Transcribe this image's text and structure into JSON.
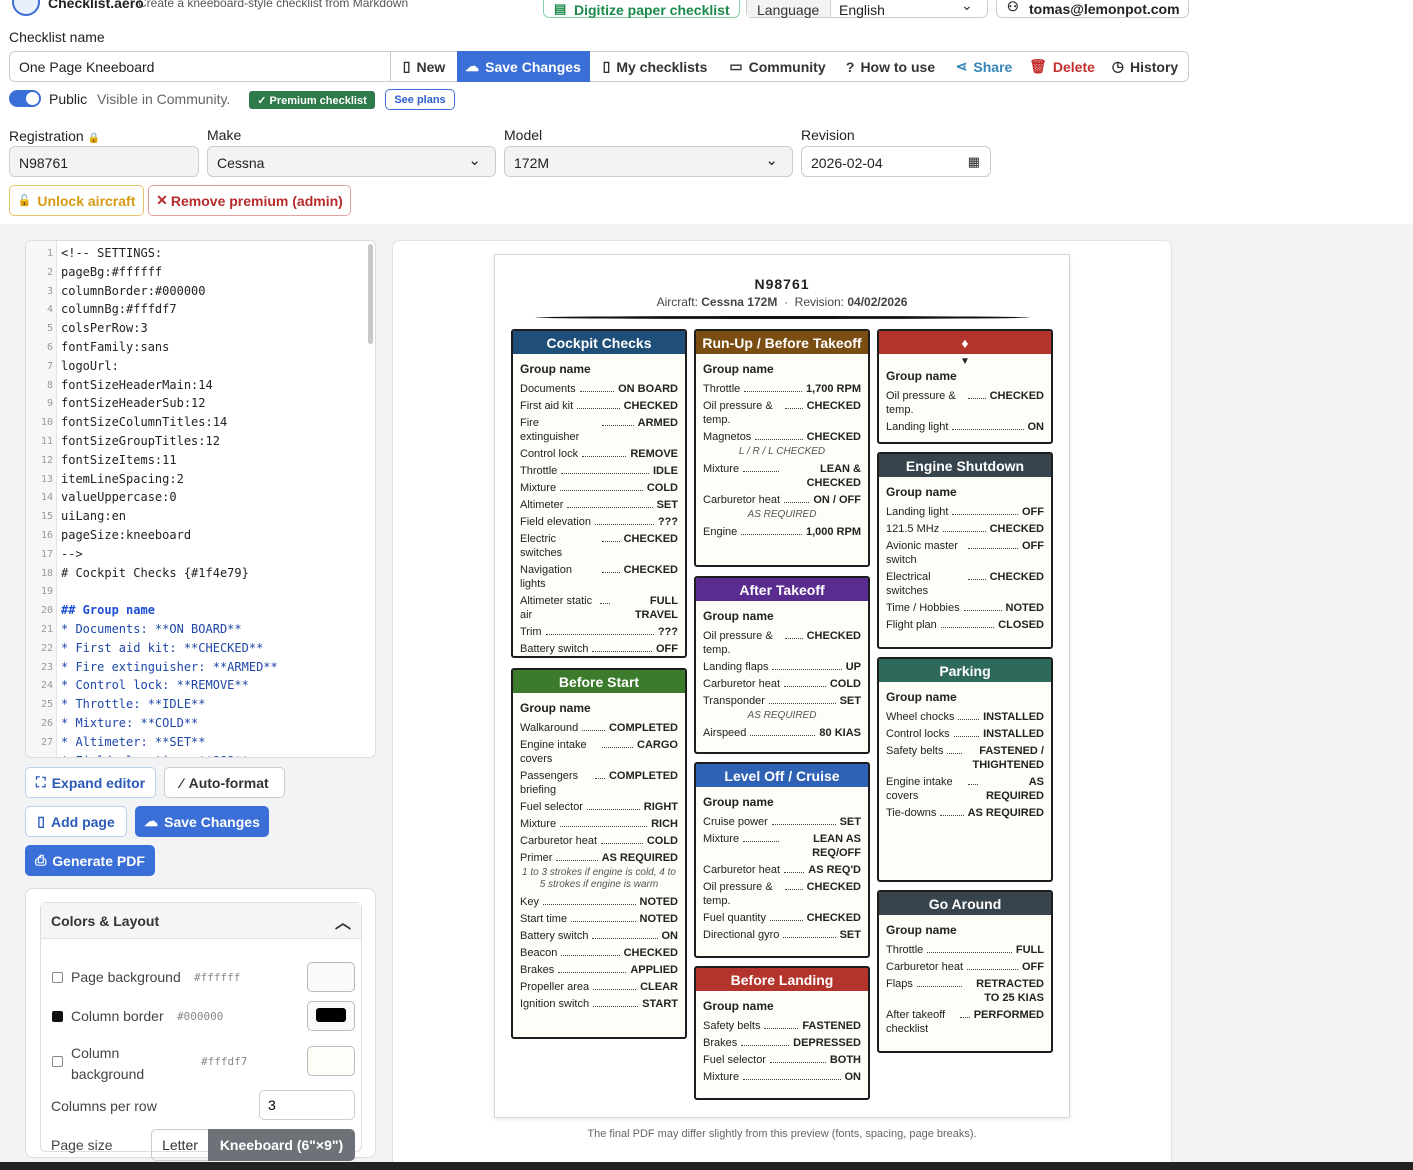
{
  "app": {
    "name": "Checklist.aero",
    "tagline": "Create a kneeboard-style checklist from Markdown",
    "digitize_label": "Digitize paper checklist",
    "language_label": "Language",
    "language_value": "English",
    "user": "tomas@lemonpot.com"
  },
  "checklist": {
    "name_label": "Checklist name",
    "name_value": "One Page Kneeboard"
  },
  "toolbar": {
    "new": "New",
    "save": "Save Changes",
    "my": "My checklists",
    "community": "Community",
    "how": "How to use",
    "share": "Share",
    "delete": "Delete",
    "history": "History"
  },
  "visibility": {
    "public_label": "Public",
    "hint": "Visible in Community.",
    "premium": "✓ Premium checklist",
    "see_plans": "See plans"
  },
  "aircraft": {
    "registration_label": "Registration",
    "registration_value": "N98761",
    "make_label": "Make",
    "make_value": "Cessna",
    "model_label": "Model",
    "model_value": "172M",
    "revision_label": "Revision",
    "revision_value": "2026-02-04",
    "unlock": "Unlock aircraft",
    "remove_premium": "Remove premium (admin)"
  },
  "editor": {
    "lines": [
      "<!-- SETTINGS:",
      "pageBg:#ffffff",
      "columnBorder:#000000",
      "columnBg:#fffdf7",
      "colsPerRow:3",
      "fontFamily:sans",
      "logoUrl:",
      "fontSizeHeaderMain:14",
      "fontSizeHeaderSub:12",
      "fontSizeColumnTitles:14",
      "fontSizeGroupTitles:12",
      "fontSizeItems:11",
      "itemLineSpacing:2",
      "valueUppercase:0",
      "uiLang:en",
      "pageSize:kneeboard",
      "-->",
      "# Cockpit Checks {#1f4e79}",
      "",
      "## Group name",
      "* Documents: **ON BOARD**",
      "* First aid kit: **CHECKED**",
      "* Fire extinguisher: **ARMED**",
      "* Control lock: **REMOVE**",
      "* Throttle: **IDLE**",
      "* Mixture: **COLD**",
      "* Altimeter: **SET**",
      "* Field elevation: **???**"
    ]
  },
  "side": {
    "expand": "Expand editor",
    "autoformat": "Auto-format",
    "add_page": "Add page",
    "save": "Save Changes",
    "pdf": "Generate PDF"
  },
  "colors": {
    "title": "Colors & Layout",
    "page_bg_label": "Page background",
    "page_bg": "#ffffff",
    "col_border_label": "Column border",
    "col_border": "#000000",
    "col_bg_label": "Column background",
    "col_bg": "#fffdf7",
    "cols_label": "Columns per row",
    "cols_value": "3",
    "page_size_label": "Page size",
    "size_letter": "Letter",
    "size_knee": "Kneeboard (6\"×9\")",
    "accent": "#3b6fd8"
  },
  "preview": {
    "registration": "N98761",
    "aircraft_label": "Aircraft:",
    "aircraft_value": "Cessna 172M",
    "sep": "·",
    "revision_label": "Revision:",
    "revision_value": "04/02/2026",
    "footnote": "The final PDF may differ slightly from this preview (fonts, spacing, page breaks)."
  },
  "columns": {
    "cockpit": {
      "title": "Cockpit Checks",
      "color": "#1f4e79",
      "group": "Group name",
      "items": [
        [
          "Documents",
          "ON BOARD"
        ],
        [
          "First aid kit",
          "CHECKED"
        ],
        [
          "Fire extinguisher",
          "ARMED"
        ],
        [
          "Control lock",
          "REMOVE"
        ],
        [
          "Throttle",
          "IDLE"
        ],
        [
          "Mixture",
          "COLD"
        ],
        [
          "Altimeter",
          "SET"
        ],
        [
          "Field elevation",
          "???"
        ],
        [
          "Electric switches",
          "CHECKED"
        ],
        [
          "Navigation lights",
          "CHECKED"
        ],
        [
          "Altimeter static air",
          "FULL TRAVEL"
        ],
        [
          "Trim",
          "???"
        ],
        [
          "Battery switch",
          "OFF"
        ]
      ]
    },
    "start": {
      "title": "Before Start",
      "color": "#3c7a2c",
      "group": "Group name",
      "items": [
        [
          "Walkaround",
          "COMPLETED"
        ],
        [
          "Engine intake covers",
          "CARGO"
        ],
        [
          "Passengers briefing",
          "COMPLETED"
        ],
        [
          "Fuel selector",
          "RIGHT"
        ],
        [
          "Mixture",
          "RICH"
        ],
        [
          "Carburetor heat",
          "COLD"
        ],
        [
          "Primer",
          "AS REQUIRED"
        ]
      ],
      "note": "1 to 3 strokes if engine is cold, 4 to 5 strokes if engine is warm",
      "items2": [
        [
          "Key",
          "NOTED"
        ],
        [
          "Start time",
          "NOTED"
        ],
        [
          "Battery switch",
          "ON"
        ],
        [
          "Beacon",
          "CHECKED"
        ],
        [
          "Brakes",
          "APPLIED"
        ],
        [
          "Propeller area",
          "CLEAR"
        ],
        [
          "Ignition switch",
          "START"
        ]
      ]
    },
    "runup": {
      "title": "Run-Up / Before Takeoff",
      "color": "#7a4e12",
      "group": "Group name",
      "items": [
        [
          "Throttle",
          "1,700 RPM"
        ],
        [
          "Oil pressure & temp.",
          "CHECKED"
        ],
        [
          "Magnetos",
          "CHECKED"
        ]
      ],
      "note1": "L / R / L CHECKED",
      "items2": [
        [
          "Mixture",
          "LEAN & CHECKED"
        ],
        [
          "Carburetor heat",
          "ON / OFF"
        ]
      ],
      "note2": "AS REQUIRED",
      "items3": [
        [
          "Engine",
          "1,000 RPM"
        ]
      ]
    },
    "after": {
      "title": "After Takeoff",
      "color": "#5b2c8f",
      "group": "Group name",
      "items": [
        [
          "Oil pressure & temp.",
          "CHECKED"
        ],
        [
          "Landing flaps",
          "UP"
        ],
        [
          "Carburetor heat",
          "COLD"
        ],
        [
          "Transponder",
          "SET"
        ]
      ],
      "note": "AS REQUIRED",
      "items2": [
        [
          "Airspeed",
          "80 KIAS"
        ]
      ]
    },
    "cruise": {
      "title": "Level Off / Cruise",
      "color": "#2f62b5",
      "group": "Group name",
      "items": [
        [
          "Cruise power",
          "SET"
        ],
        [
          "Mixture",
          "LEAN AS REQ/OFF"
        ],
        [
          "Carburetor heat",
          "AS REQ'D"
        ],
        [
          "Oil pressure & temp.",
          "CHECKED"
        ],
        [
          "Fuel quantity",
          "CHECKED"
        ],
        [
          "Directional gyro",
          "SET"
        ]
      ]
    },
    "landing": {
      "title": "Before Landing",
      "color": "#b3342c",
      "group": "Group name",
      "items": [
        [
          "Safety belts",
          "FASTENED"
        ],
        [
          "Brakes",
          "DEPRESSED"
        ],
        [
          "Fuel selector",
          "BOTH"
        ],
        [
          "Mixture",
          "ON"
        ]
      ]
    },
    "top": {
      "title": "♦",
      "color": "#b3342c",
      "arrow": "▼",
      "group": "Group name",
      "items": [
        [
          "Oil pressure & temp.",
          "CHECKED"
        ],
        [
          "Landing light",
          "ON"
        ]
      ]
    },
    "shutdown": {
      "title": "Engine Shutdown",
      "color": "#37444d",
      "group": "Group name",
      "items": [
        [
          "Landing light",
          "OFF"
        ],
        [
          "121.5 MHz",
          "CHECKED"
        ],
        [
          "Avionic master switch",
          "OFF"
        ],
        [
          "Electrical switches",
          "CHECKED"
        ],
        [
          "Time / Hobbies",
          "NOTED"
        ],
        [
          "Flight plan",
          "CLOSED"
        ]
      ]
    },
    "parking": {
      "title": "Parking",
      "color": "#2d6a5c",
      "group": "Group name",
      "items": [
        [
          "Wheel chocks",
          "INSTALLED"
        ],
        [
          "Control locks",
          "INSTALLED"
        ],
        [
          "Safety belts",
          "FASTENED / THIGHTENED"
        ],
        [
          "Engine intake covers",
          "AS REQUIRED"
        ],
        [
          "Tie-downs",
          "AS REQUIRED"
        ]
      ]
    },
    "goaround": {
      "title": "Go Around",
      "color": "#37444d",
      "group": "Group name",
      "items": [
        [
          "Throttle",
          "FULL"
        ],
        [
          "Carburetor heat",
          "OFF"
        ],
        [
          "Flaps",
          "RETRACTED TO 25 KIAS"
        ],
        [
          "After takeoff checklist",
          "PERFORMED"
        ]
      ]
    }
  }
}
